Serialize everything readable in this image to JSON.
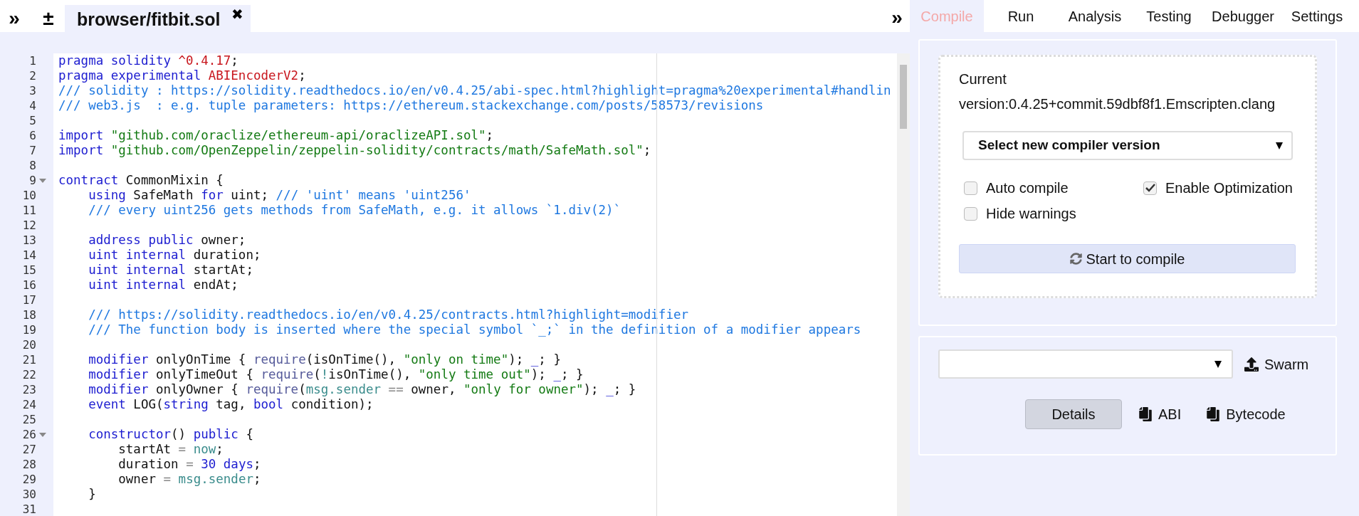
{
  "left_toolbar": {
    "collapse": "»",
    "font_size": "±"
  },
  "file_tabs": [
    {
      "label": "browser/fitbit.sol",
      "close": "✖",
      "selected": true
    }
  ],
  "panel_toggle": "»",
  "editor": {
    "lines": [
      {
        "number": "1",
        "foldable": false,
        "tokens": [
          {
            "kind": "keyword",
            "text": "pragma solidity "
          },
          {
            "kind": "version",
            "text": "^0.4.17"
          },
          {
            "kind": "plain",
            "text": ";"
          }
        ]
      },
      {
        "number": "2",
        "foldable": false,
        "tokens": [
          {
            "kind": "keyword",
            "text": "pragma experimental "
          },
          {
            "kind": "version",
            "text": "ABIEncoderV2"
          },
          {
            "kind": "plain",
            "text": ";"
          }
        ]
      },
      {
        "number": "3",
        "foldable": false,
        "tokens": [
          {
            "kind": "comment",
            "text": "/// solidity : https://solidity.readthedocs.io/en/v0.4.25/abi-spec.html?highlight=pragma%20experimental#handlin"
          }
        ]
      },
      {
        "number": "4",
        "foldable": false,
        "tokens": [
          {
            "kind": "comment",
            "text": "/// web3.js  : e.g. tuple parameters: https://ethereum.stackexchange.com/posts/58573/revisions"
          }
        ]
      },
      {
        "number": "5",
        "foldable": false
      },
      {
        "number": "6",
        "foldable": false,
        "tokens": [
          {
            "kind": "keyword",
            "text": "import "
          },
          {
            "kind": "string",
            "text": "\"github.com/oraclize/ethereum-api/oraclizeAPI.sol\""
          },
          {
            "kind": "plain",
            "text": ";"
          }
        ]
      },
      {
        "number": "7",
        "foldable": false,
        "tokens": [
          {
            "kind": "keyword",
            "text": "import "
          },
          {
            "kind": "string",
            "text": "\"github.com/OpenZeppelin/zeppelin-solidity/contracts/math/SafeMath.sol\""
          },
          {
            "kind": "plain",
            "text": ";"
          }
        ]
      },
      {
        "number": "8",
        "foldable": false
      },
      {
        "number": "9",
        "foldable": true,
        "tokens": [
          {
            "kind": "keyword",
            "text": "contract "
          },
          {
            "kind": "plain",
            "text": "CommonMixin {"
          }
        ]
      },
      {
        "number": "10",
        "foldable": false,
        "tokens": [
          {
            "kind": "keyword",
            "text": "    using "
          },
          {
            "kind": "plain",
            "text": "SafeMath "
          },
          {
            "kind": "keyword",
            "text": "for "
          },
          {
            "kind": "plain",
            "text": "uint; "
          },
          {
            "kind": "comment",
            "text": "/// 'uint' means 'uint256'"
          }
        ]
      },
      {
        "number": "11",
        "foldable": false,
        "tokens": [
          {
            "kind": "comment",
            "text": "    /// every uint256 gets methods from SafeMath, e.g. it allows `1.div(2)`"
          }
        ]
      },
      {
        "number": "12",
        "foldable": false
      },
      {
        "number": "13",
        "foldable": false,
        "tokens": [
          {
            "kind": "keyword",
            "text": "    address public "
          },
          {
            "kind": "plain",
            "text": "owner;"
          }
        ]
      },
      {
        "number": "14",
        "foldable": false,
        "tokens": [
          {
            "kind": "keyword",
            "text": "    uint internal "
          },
          {
            "kind": "plain",
            "text": "duration;"
          }
        ]
      },
      {
        "number": "15",
        "foldable": false,
        "tokens": [
          {
            "kind": "keyword",
            "text": "    uint internal "
          },
          {
            "kind": "plain",
            "text": "startAt;"
          }
        ]
      },
      {
        "number": "16",
        "foldable": false,
        "tokens": [
          {
            "kind": "keyword",
            "text": "    uint internal "
          },
          {
            "kind": "plain",
            "text": "endAt;"
          }
        ]
      },
      {
        "number": "17",
        "foldable": false
      },
      {
        "number": "18",
        "foldable": false,
        "tokens": [
          {
            "kind": "comment",
            "text": "    /// https://solidity.readthedocs.io/en/v0.4.25/contracts.html?highlight=modifier"
          }
        ]
      },
      {
        "number": "19",
        "foldable": false,
        "tokens": [
          {
            "kind": "comment",
            "text": "    /// The function body is inserted where the special symbol `_;` in the definition of a modifier appears"
          }
        ]
      },
      {
        "number": "20",
        "foldable": false
      },
      {
        "number": "21",
        "foldable": false,
        "tokens": [
          {
            "kind": "keyword",
            "text": "    modifier "
          },
          {
            "kind": "plain",
            "text": "onlyOnTime { "
          },
          {
            "kind": "builtin",
            "text": "require"
          },
          {
            "kind": "plain",
            "text": "(isOnTime(), "
          },
          {
            "kind": "string",
            "text": "\"only on time\""
          },
          {
            "kind": "plain",
            "text": "); "
          },
          {
            "kind": "keyword",
            "text": "_"
          },
          {
            "kind": "plain",
            "text": "; }"
          }
        ]
      },
      {
        "number": "22",
        "foldable": false,
        "tokens": [
          {
            "kind": "keyword",
            "text": "    modifier "
          },
          {
            "kind": "plain",
            "text": "onlyTimeOut { "
          },
          {
            "kind": "builtin",
            "text": "require"
          },
          {
            "kind": "plain",
            "text": "("
          },
          {
            "kind": "variable",
            "text": "!"
          },
          {
            "kind": "plain",
            "text": "isOnTime(), "
          },
          {
            "kind": "string",
            "text": "\"only time out\""
          },
          {
            "kind": "plain",
            "text": "); "
          },
          {
            "kind": "keyword",
            "text": "_"
          },
          {
            "kind": "plain",
            "text": "; }"
          }
        ]
      },
      {
        "number": "23",
        "foldable": false,
        "tokens": [
          {
            "kind": "keyword",
            "text": "    modifier "
          },
          {
            "kind": "plain",
            "text": "onlyOwner { "
          },
          {
            "kind": "builtin",
            "text": "require"
          },
          {
            "kind": "plain",
            "text": "("
          },
          {
            "kind": "variable",
            "text": "msg.sender"
          },
          {
            "kind": "operator",
            "text": " == "
          },
          {
            "kind": "plain",
            "text": "owner, "
          },
          {
            "kind": "string",
            "text": "\"only for owner\""
          },
          {
            "kind": "plain",
            "text": "); "
          },
          {
            "kind": "keyword",
            "text": "_"
          },
          {
            "kind": "plain",
            "text": "; }"
          }
        ]
      },
      {
        "number": "24",
        "foldable": false,
        "tokens": [
          {
            "kind": "keyword",
            "text": "    event "
          },
          {
            "kind": "plain",
            "text": "LOG("
          },
          {
            "kind": "keyword",
            "text": "string "
          },
          {
            "kind": "plain",
            "text": "tag, "
          },
          {
            "kind": "keyword",
            "text": "bool "
          },
          {
            "kind": "plain",
            "text": "condition);"
          }
        ]
      },
      {
        "number": "25",
        "foldable": false
      },
      {
        "number": "26",
        "foldable": true,
        "tokens": [
          {
            "kind": "keyword",
            "text": "    constructor"
          },
          {
            "kind": "plain",
            "text": "() "
          },
          {
            "kind": "keyword",
            "text": "public "
          },
          {
            "kind": "plain",
            "text": "{"
          }
        ]
      },
      {
        "number": "27",
        "foldable": false,
        "tokens": [
          {
            "kind": "plain",
            "text": "        startAt "
          },
          {
            "kind": "operator",
            "text": "= "
          },
          {
            "kind": "variable",
            "text": "now"
          },
          {
            "kind": "plain",
            "text": ";"
          }
        ]
      },
      {
        "number": "28",
        "foldable": false,
        "tokens": [
          {
            "kind": "plain",
            "text": "        duration "
          },
          {
            "kind": "operator",
            "text": "= "
          },
          {
            "kind": "keyword",
            "text": "30 days"
          },
          {
            "kind": "plain",
            "text": ";"
          }
        ]
      },
      {
        "number": "29",
        "foldable": false,
        "tokens": [
          {
            "kind": "plain",
            "text": "        owner "
          },
          {
            "kind": "operator",
            "text": "= "
          },
          {
            "kind": "variable",
            "text": "msg.sender"
          },
          {
            "kind": "plain",
            "text": ";"
          }
        ]
      },
      {
        "number": "30",
        "foldable": false,
        "tokens": [
          {
            "kind": "plain",
            "text": "    }"
          }
        ]
      },
      {
        "number": "31",
        "foldable": false
      }
    ]
  },
  "panel_tabs": [
    {
      "label": "Compile",
      "selected": true
    },
    {
      "label": "Run",
      "selected": false
    },
    {
      "label": "Analysis",
      "selected": false
    },
    {
      "label": "Testing",
      "selected": false
    },
    {
      "label": "Debugger",
      "selected": false
    },
    {
      "label": "Settings",
      "selected": false
    }
  ],
  "compiler": {
    "current_version": "Current version:0.4.25+commit.59dbf8f1.Emscripten.clang",
    "version_select": "Select new compiler version",
    "options": [
      {
        "label": "Auto compile",
        "checked": false
      },
      {
        "label": "Enable Optimization",
        "checked": true
      },
      {
        "label": "Hide warnings",
        "checked": false
      }
    ],
    "compile_button": "Start to compile"
  },
  "contract": {
    "publish_button": "Swarm",
    "details_button": "Details",
    "copy_buttons": [
      "ABI",
      "Bytecode"
    ]
  }
}
